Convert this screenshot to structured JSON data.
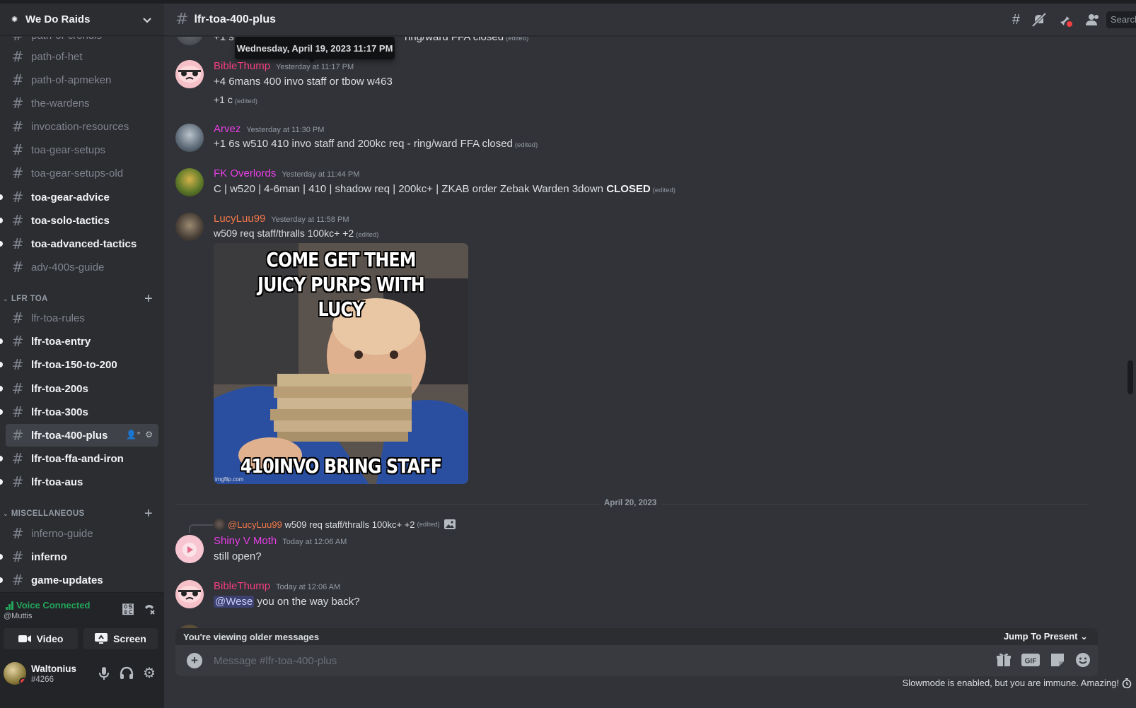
{
  "server": {
    "name": "We Do Raids"
  },
  "channels_top": [
    {
      "label": "path-of-crondis",
      "unread": false
    },
    {
      "label": "path-of-het",
      "unread": false
    },
    {
      "label": "path-of-apmeken",
      "unread": false
    },
    {
      "label": "the-wardens",
      "unread": false
    },
    {
      "label": "invocation-resources",
      "unread": false
    },
    {
      "label": "toa-gear-setups",
      "unread": false
    },
    {
      "label": "toa-gear-setups-old",
      "unread": false
    },
    {
      "label": "toa-gear-advice",
      "unread": true
    },
    {
      "label": "toa-solo-tactics",
      "unread": true
    },
    {
      "label": "toa-advanced-tactics",
      "unread": true
    },
    {
      "label": "adv-400s-guide",
      "unread": false
    }
  ],
  "categories": {
    "lfr": "LFR TOA",
    "misc": "MISCELLANEOUS"
  },
  "channels_lfr": [
    {
      "label": "lfr-toa-rules",
      "unread": false
    },
    {
      "label": "lfr-toa-entry",
      "unread": true
    },
    {
      "label": "lfr-toa-150-to-200",
      "unread": true
    },
    {
      "label": "lfr-toa-200s",
      "unread": true
    },
    {
      "label": "lfr-toa-300s",
      "unread": true
    },
    {
      "label": "lfr-toa-400-plus",
      "selected": true
    },
    {
      "label": "lfr-toa-ffa-and-iron",
      "unread": true
    },
    {
      "label": "lfr-toa-aus",
      "unread": true
    }
  ],
  "channels_misc": [
    {
      "label": "inferno-guide",
      "unread": false
    },
    {
      "label": "inferno",
      "unread": true
    },
    {
      "label": "game-updates",
      "unread": true
    }
  ],
  "voice": {
    "status": "Voice Connected",
    "user": "@Muttis",
    "video_label": "Video",
    "screen_label": "Screen"
  },
  "user": {
    "name": "Waltonius",
    "tag": "#4266"
  },
  "header": {
    "channel": "lfr-toa-400-plus",
    "search": "Search"
  },
  "tooltip": "Wednesday, April 19, 2023 11:17 PM",
  "partial_msg": {
    "text_left": "+1 s",
    "text_right": "ring/ward FFA closed",
    "edited": "(edited)"
  },
  "messages": [
    {
      "author": "BibleThump",
      "color": "#f23f7d",
      "time": "Yesterday at 11:17 PM",
      "lines": [
        "+4 6mans 400 invo staff or tbow w463"
      ],
      "line2": "+1 c",
      "edited": "(edited)"
    },
    {
      "author": "Arvez",
      "color": "#e93ee6",
      "time": "Yesterday at 11:30 PM",
      "text": "+1 6s w510 410 invo staff and 200kc req - ring/ward FFA closed",
      "edited": "(edited)"
    },
    {
      "author": "FK Overlords",
      "color": "#e93ee6",
      "time": "Yesterday at 11:44 PM",
      "text": "C | w520 | 4-6man | 410 | shadow req | 200kc+ | ZKAB order Zebak Warden 3down",
      "bold": "CLOSED",
      "edited": "(edited)"
    },
    {
      "author": "LucyLuu99",
      "color": "#f2784b",
      "time": "Yesterday at 11:58 PM",
      "text": "w509  req staff/thralls 100kc+ +2",
      "edited": "(edited)"
    }
  ],
  "meme": {
    "top1": "COME GET THEM",
    "top2": "JUICY PURPS WITH LUCY",
    "bottom": "410INVO BRING STAFF",
    "watermark": "imgflip.com"
  },
  "date_divider": "April 20, 2023",
  "reply": {
    "mention": "@LucyLuu99",
    "text": "w509 req staff/thralls 100kc+ +2",
    "edited": "(edited)"
  },
  "messages2": [
    {
      "author": "Shiny V Moth",
      "color": "#e93ee6",
      "time": "Today at 12:06 AM",
      "text": "still open?"
    },
    {
      "author": "BibleThump",
      "color": "#f23f7d",
      "time": "Today at 12:06 AM",
      "mention": "@Wese",
      "text": " you on the way back?"
    }
  ],
  "older_bar": {
    "text": "You're viewing older messages",
    "jump": "Jump To Present"
  },
  "composer": {
    "placeholder": "Message #lfr-toa-400-plus"
  },
  "slowmode": "Slowmode is enabled, but you are immune. Amazing!"
}
